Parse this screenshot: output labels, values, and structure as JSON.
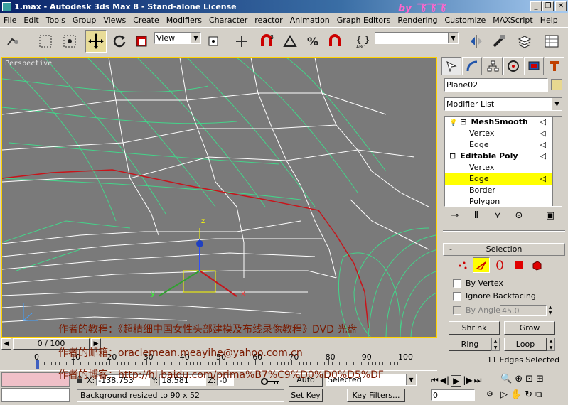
{
  "window": {
    "title": "1.max - Autodesk 3ds Max 8  - Stand-alone License",
    "minimize": "_",
    "restore": "❐",
    "close": "✕",
    "watermark": "by 飞飞飞"
  },
  "menu": [
    "File",
    "Edit",
    "Tools",
    "Group",
    "Views",
    "Create",
    "Modifiers",
    "Character",
    "reactor",
    "Animation",
    "Graph Editors",
    "Rendering",
    "Customize",
    "MAXScript",
    "Help"
  ],
  "toolbar": {
    "coord_system": "View",
    "named_selection": ""
  },
  "viewport": {
    "label": "Perspective",
    "gizmo_x": "x",
    "gizmo_y": "y",
    "gizmo_z": "z"
  },
  "panel": {
    "object_name": "Plane02",
    "modifier_list": "Modifier List",
    "stack": [
      {
        "label": "MeshSmooth",
        "level": 0,
        "bold": true
      },
      {
        "label": "Vertex",
        "level": 1
      },
      {
        "label": "Edge",
        "level": 1
      },
      {
        "label": "Editable Poly",
        "level": 0,
        "bold": true
      },
      {
        "label": "Vertex",
        "level": 1
      },
      {
        "label": "Edge",
        "level": 1,
        "selected": true
      },
      {
        "label": "Border",
        "level": 1
      },
      {
        "label": "Polygon",
        "level": 1
      }
    ],
    "selection": {
      "header": "Selection",
      "header_toggle": "-",
      "by_vertex": "By Vertex",
      "ignore_backfacing": "Ignore Backfacing",
      "by_angle": "By Angle:",
      "angle_value": "45.0",
      "shrink": "Shrink",
      "grow": "Grow",
      "ring": "Ring",
      "loop": "Loop",
      "status": "11 Edges Selected"
    }
  },
  "timeline": {
    "frame": "0 / 100",
    "ticks": [
      "0",
      "10",
      "20",
      "30",
      "40",
      "50",
      "60",
      "70",
      "80",
      "90",
      "100"
    ]
  },
  "status": {
    "x_label": "X:",
    "x_value": "-138.753",
    "y_label": "Y:",
    "y_value": "18.581",
    "z_label": "Z:",
    "z_value": "-0",
    "prompt": "Background resized to 90 x 52",
    "auto_key": "Auto Key",
    "set_key": "Set Key",
    "selected": "Selected",
    "key_filters": "Key Filters...",
    "current_frame": "0"
  },
  "overlay": {
    "line1": "作者的教程：《超精细中国女性头部建模及布线录像教程》DVD 光盘",
    "line2": "作者的邮箱：oraclemean.meayihe@yahoo.com.cn",
    "line3": "作者的博客：http://hi.baidu.com/prima%B7%C9%D0%D0%D5%DF"
  },
  "colors": {
    "selected_edge": "#c8141a",
    "mesh": "#ffffff",
    "grid_mesh": "#44d48a",
    "highlight": "#ffff00",
    "overlay_text": "#7a1a00"
  }
}
